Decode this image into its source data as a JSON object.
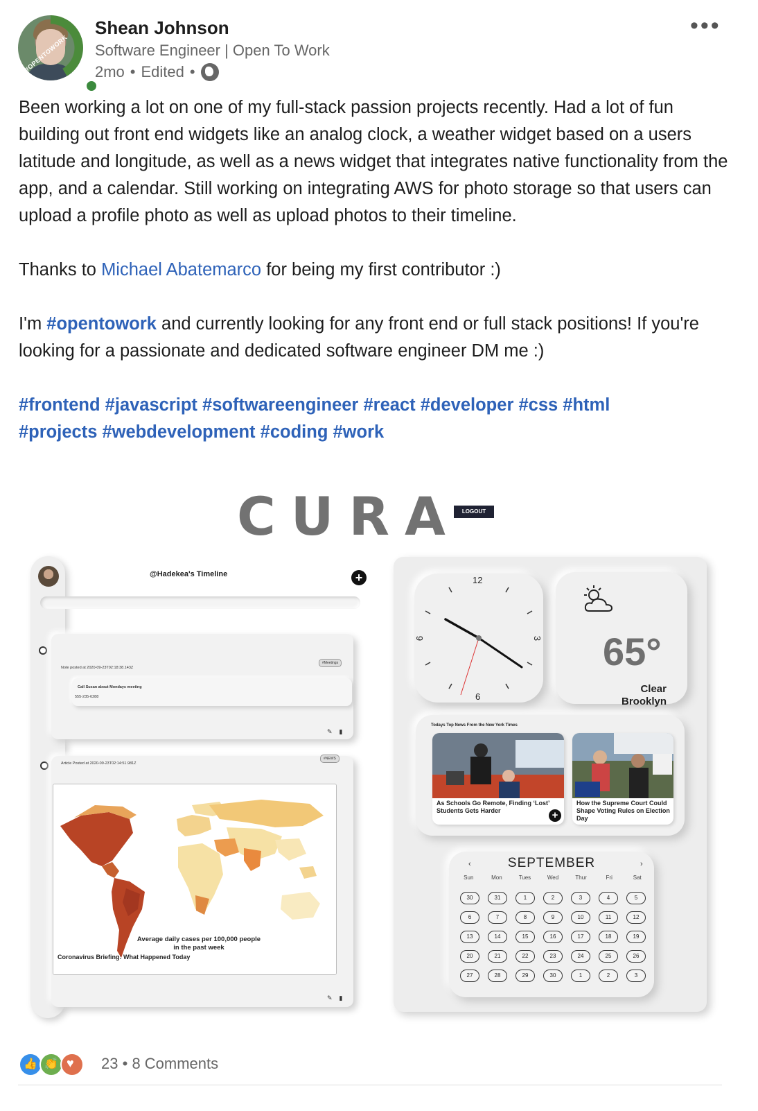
{
  "author": {
    "name": "Shean Johnson",
    "headline": "Software Engineer | Open To Work",
    "time": "2mo",
    "edited": "Edited",
    "badge_text": "#OPENTOWORK",
    "visibility_icon": "globe-icon"
  },
  "menu_icon": "more-horizontal-icon",
  "post": {
    "para1": "Been working a lot on one of my full-stack passion projects recently. Had a lot of fun building out front end widgets like an analog clock, a weather widget based on a users latitude and longitude, as well as a news widget that integrates native functionality from the app, and a calendar. Still working on integrating AWS for photo storage so that users can upload a profile photo as well as upload photos to their timeline.",
    "thanks_prefix": "Thanks to ",
    "mention": "Michael Abatemarco",
    "thanks_suffix": " for being my first contributor :)",
    "opentowork_prefix": "I'm ",
    "opentowork_tag": "#opentowork",
    "opentowork_suffix": " and currently looking for any front end or full stack positions! If you're looking for a passionate and dedicated software engineer DM me :)",
    "hashtags_line1": [
      "#frontend",
      "#javascript",
      "#softwareengineer",
      "#react",
      "#developer",
      "#css",
      "#html"
    ],
    "hashtags_line2": [
      "#projects",
      "#webdevelopment",
      "#coding",
      "#work"
    ]
  },
  "app": {
    "logo": "CURA",
    "logout": "LOGOUT",
    "timeline": {
      "title": "@Hadekea's Timeline",
      "note": {
        "posted": "Note posted at 2020-09-23T02:18:38.143Z",
        "tag": "#Meetings",
        "text": "Call Susan about Mondays meeting",
        "phone": "555-235-6288"
      },
      "article": {
        "posted": "Article Posted at 2020-09-23T02:14:51.981Z",
        "tag": "#NEWS",
        "map_caption_1": "Average daily cases per 100,000 people",
        "map_caption_2": "in the past week",
        "headline": "Coronavirus Briefing: What Happened Today"
      }
    },
    "clock": {
      "twelve": "12",
      "three": "3",
      "six": "6",
      "nine": "9"
    },
    "weather": {
      "temp": "65°",
      "condition": "Clear",
      "location": "Brooklyn"
    },
    "news": {
      "title": "Todays Top News From the New York Times",
      "story1": "As Schools Go Remote, Finding ‘Lost’ Students Gets Harder",
      "story2": "How the Supreme Court Could Shape Voting Rules on Election Day"
    },
    "calendar": {
      "month": "SEPTEMBER",
      "prev": "‹",
      "next": "›",
      "weekdays": [
        "Sun",
        "Mon",
        "Tues",
        "Wed",
        "Thur",
        "Fri",
        "Sat"
      ],
      "days": [
        "30",
        "31",
        "1",
        "2",
        "3",
        "4",
        "5",
        "6",
        "7",
        "8",
        "9",
        "10",
        "11",
        "12",
        "13",
        "14",
        "15",
        "16",
        "17",
        "18",
        "19",
        "20",
        "21",
        "22",
        "23",
        "24",
        "25",
        "26",
        "27",
        "28",
        "29",
        "30",
        "1",
        "2",
        "3"
      ]
    }
  },
  "social": {
    "reaction_icons": [
      "like-icon",
      "celebrate-icon",
      "love-icon"
    ],
    "count": "23",
    "separator": "•",
    "comments": "8 Comments"
  }
}
